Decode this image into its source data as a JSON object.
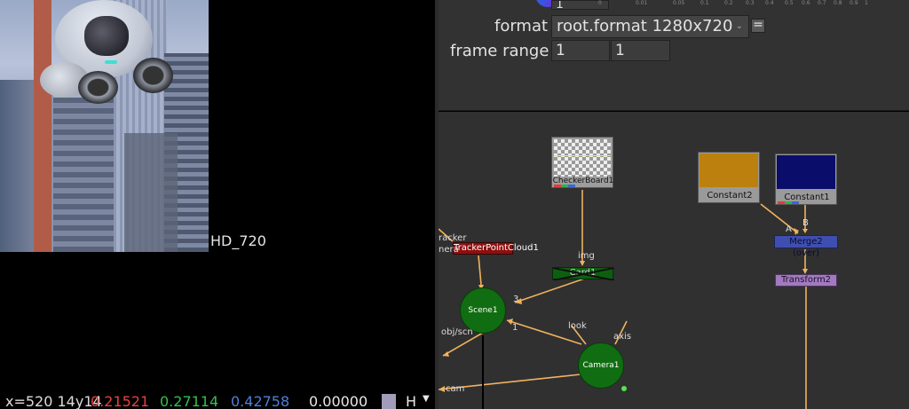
{
  "viewer": {
    "format_label": "HD_720",
    "infobar": {
      "coord": "x=520 14y14",
      "r": "0.21521",
      "g": "0.27114",
      "b": "0.42758",
      "a": "0.00000",
      "channel": "H"
    }
  },
  "props": {
    "top_field_value": "1",
    "format_label": "format",
    "format_value": "root.format 1280x720",
    "format_eq": "=",
    "frame_range_label": "frame range",
    "frame_start": "1",
    "frame_end": "1",
    "ruler": [
      "0",
      "0.01",
      "0.05",
      "0.1",
      "0.2",
      "0.3",
      "0.4",
      "0.5",
      "0.6",
      "0.7",
      "0.8",
      "0.9",
      "1"
    ]
  },
  "graph": {
    "nodes": {
      "checkerboard": "CheckerBoard1",
      "constant2": "Constant2",
      "constant1": "Constant1",
      "merge": "Merge2 (over)",
      "transform": "Transform2",
      "tracker": "TrackerPointCloud1",
      "card": "Card1",
      "scene": "Scene1",
      "camera": "Camera1"
    },
    "labels": {
      "tracker_in_1": "racker",
      "tracker_in_2": "nera",
      "img": "img",
      "merge_a": "A",
      "merge_b": "B",
      "scene_port_3": "3",
      "scene_port_1": "1",
      "obj_scn": "obj/scn",
      "look": "look",
      "axis": "axis",
      "cam": "cam"
    },
    "colors": {
      "constant2": "#bb800e",
      "constant1": "#0a0d6a",
      "tracker": "#8e0f0f",
      "card": "#0d5f10",
      "merge": "#3f4fb0",
      "transform": "#a27ac0",
      "edge": "#f1b25f"
    }
  }
}
